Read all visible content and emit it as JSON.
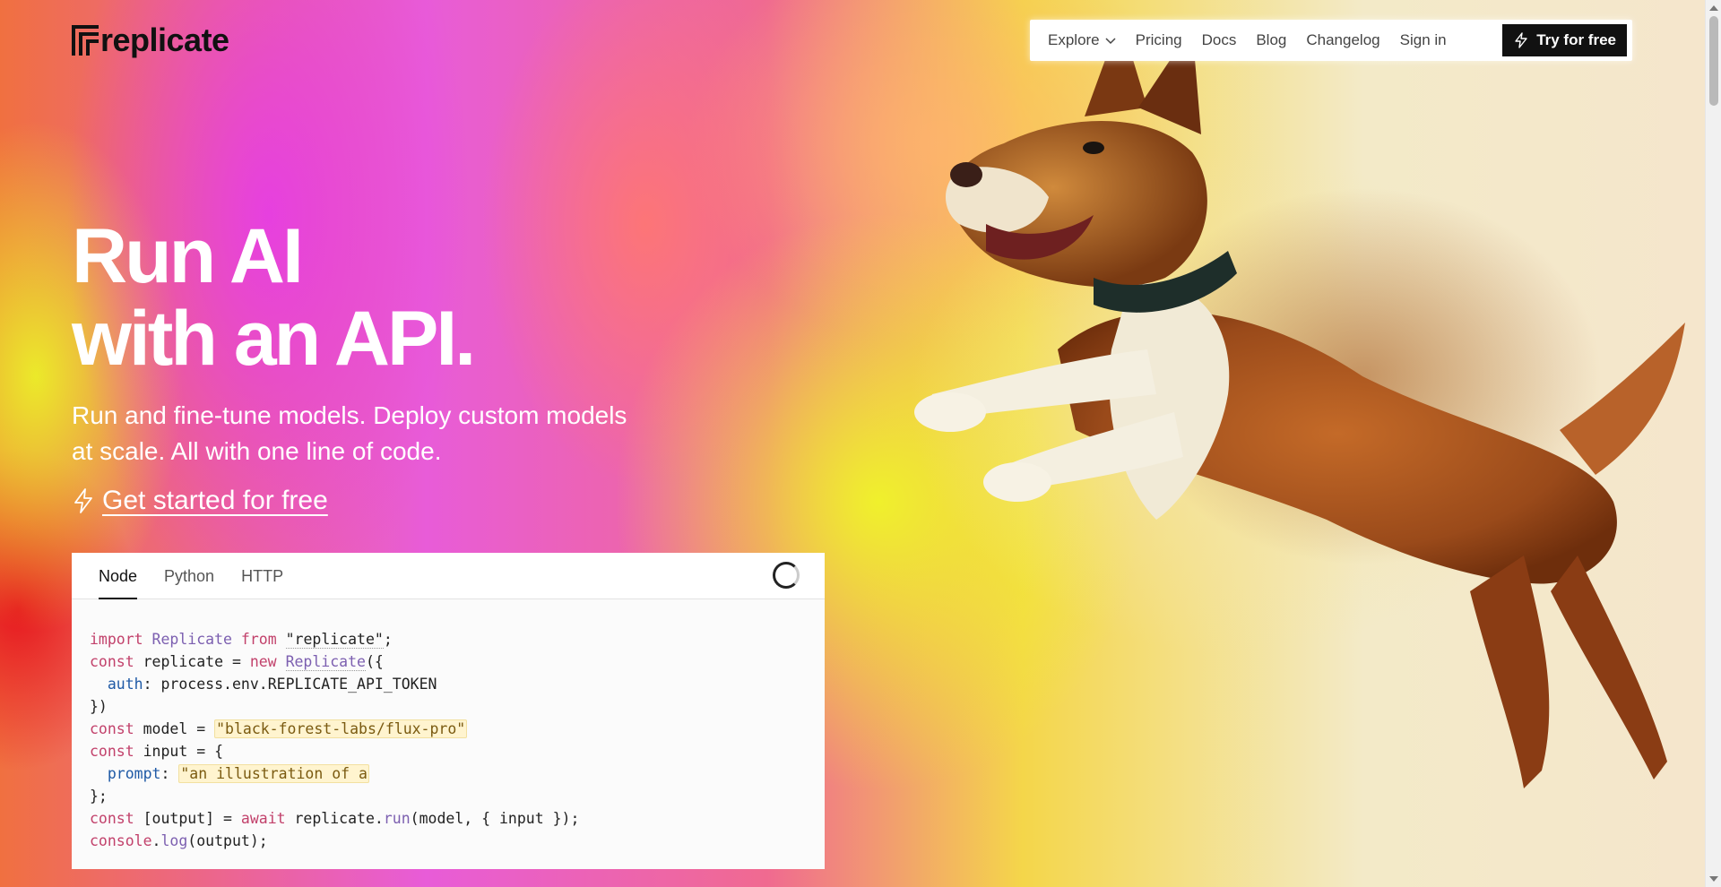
{
  "brand": {
    "name": "replicate"
  },
  "nav": {
    "items": [
      {
        "label": "Explore",
        "has_dropdown": true
      },
      {
        "label": "Pricing"
      },
      {
        "label": "Docs"
      },
      {
        "label": "Blog"
      },
      {
        "label": "Changelog"
      },
      {
        "label": "Sign in"
      }
    ],
    "cta_label": "Try for free"
  },
  "hero": {
    "title_line1": "Run AI",
    "title_line2": "with an API.",
    "subtitle": "Run and fine-tune models. Deploy custom models at scale. All with one line of code.",
    "cta_label": "Get started for free"
  },
  "code_panel": {
    "tabs": [
      {
        "label": "Node",
        "active": true
      },
      {
        "label": "Python",
        "active": false
      },
      {
        "label": "HTTP",
        "active": false
      }
    ],
    "lines": [
      "import Replicate from \"replicate\";",
      "const replicate = new Replicate({",
      "  auth: process.env.REPLICATE_API_TOKEN",
      "})",
      "const model = \"black-forest-labs/flux-pro\"",
      "const input = {",
      "  prompt: \"an illustration of a",
      "};",
      "const [output] = await replicate.run(model, { input });",
      "console.log(output);"
    ],
    "tokens": {
      "import_kw": "import",
      "replicate_cls": "Replicate",
      "from_kw": "from",
      "module_str": "\"replicate\"",
      "const_kw": "const",
      "new_kw": "new",
      "auth_prop": "auth",
      "env_path": ": process.env.REPLICATE_API_TOKEN",
      "model_str": "\"black-forest-labs/flux-pro\"",
      "prompt_prop": "prompt",
      "prompt_str": "\"an illustration of a",
      "await_kw": "await",
      "run_fn": "run",
      "log_fn": "log"
    }
  },
  "colors": {
    "nav_cta_bg": "#111111",
    "keyword": "#c2416b",
    "class_name": "#7c5fb0",
    "string_highlight": "#fff4cf"
  }
}
